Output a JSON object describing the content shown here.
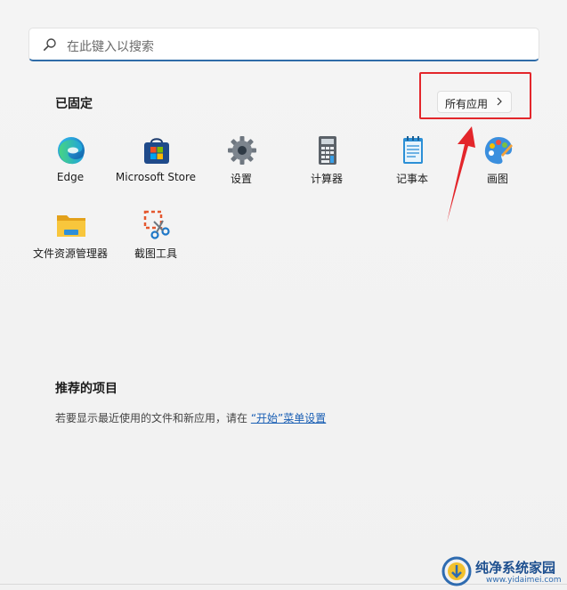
{
  "search": {
    "placeholder": "在此键入以搜索",
    "icon": "search-icon"
  },
  "pinned": {
    "title": "已固定",
    "all_apps_label": "所有应用",
    "apps": [
      {
        "label": "Edge",
        "icon": "edge-icon"
      },
      {
        "label": "Microsoft Store",
        "icon": "microsoft-store-icon"
      },
      {
        "label": "设置",
        "icon": "settings-gear-icon"
      },
      {
        "label": "计算器",
        "icon": "calculator-icon"
      },
      {
        "label": "记事本",
        "icon": "notepad-icon"
      },
      {
        "label": "画图",
        "icon": "paint-icon"
      },
      {
        "label": "文件资源管理器",
        "icon": "file-explorer-icon"
      },
      {
        "label": "截图工具",
        "icon": "snipping-tool-icon"
      }
    ]
  },
  "recommended": {
    "title": "推荐的项目",
    "text_before": "若要显示最近使用的文件和新应用，请在 ",
    "link": "“开始”菜单设置"
  },
  "watermark": {
    "title": "纯净系统家园",
    "url": "www.yidaimei.com"
  },
  "colors": {
    "accent": "#2f6ca8",
    "highlight": "#e3262b",
    "link": "#1a5fb4"
  }
}
